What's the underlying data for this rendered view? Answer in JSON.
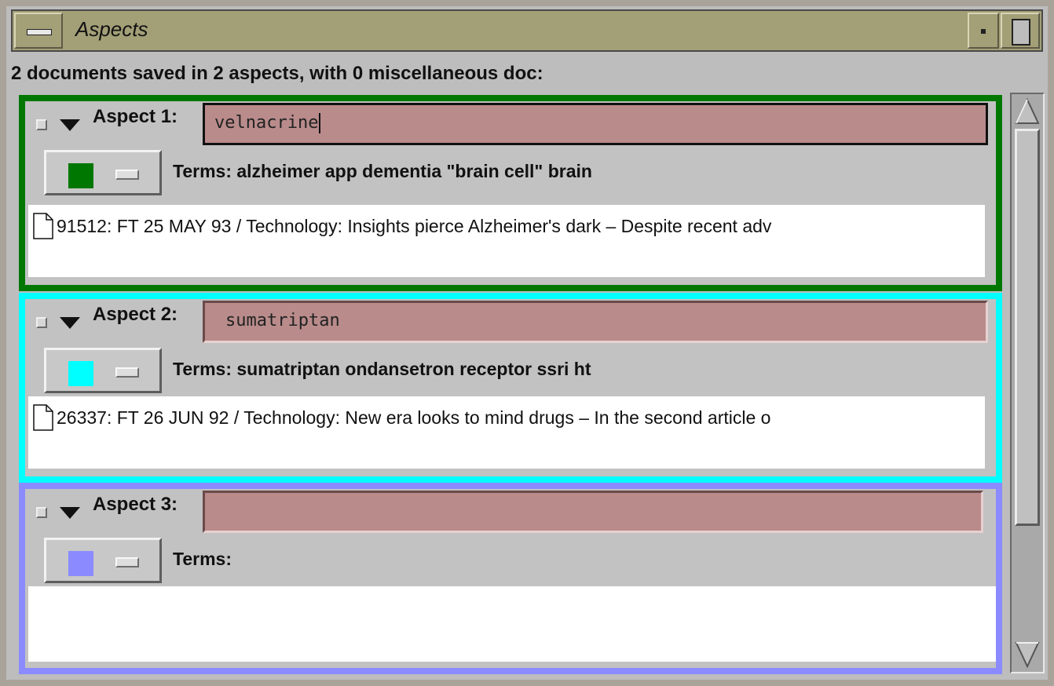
{
  "window": {
    "title": "Aspects"
  },
  "status": {
    "text": "2 documents saved in 2 aspects, with 0 miscellaneous doc:"
  },
  "aspects": [
    {
      "label": "Aspect 1:",
      "query": "velnacrine",
      "color": "#007700",
      "swatch_color": "#007700",
      "terms": "Terms:  alzheimer  app  dementia  \"brain cell\"  brain",
      "documents": [
        {
          "text": "91512:  FT  25 MAY 93 / Technology: Insights pierce Alzheimer's dark – Despite recent adv"
        }
      ]
    },
    {
      "label": "Aspect 2:",
      "query": "sumatriptan",
      "color": "#00ffff",
      "swatch_color": "#00ffff",
      "terms": "Terms:  sumatriptan  ondansetron  receptor  ssri  ht",
      "documents": [
        {
          "text": "26337:  FT  26 JUN 92 / Technology: New era looks to mind drugs – In the second article o"
        }
      ]
    },
    {
      "label": "Aspect 3:",
      "query": "",
      "color": "#8b8bff",
      "swatch_color": "#8b8bff",
      "terms": "Terms:",
      "documents": []
    }
  ],
  "icons": {
    "window_menu": "window-menu-icon",
    "minimize": "minimize-icon",
    "maximize": "maximize-icon",
    "document": "document-icon",
    "collapse": "triangle-down-icon",
    "scroll_up": "scroll-up-arrow-icon",
    "scroll_down": "scroll-down-arrow-icon"
  }
}
